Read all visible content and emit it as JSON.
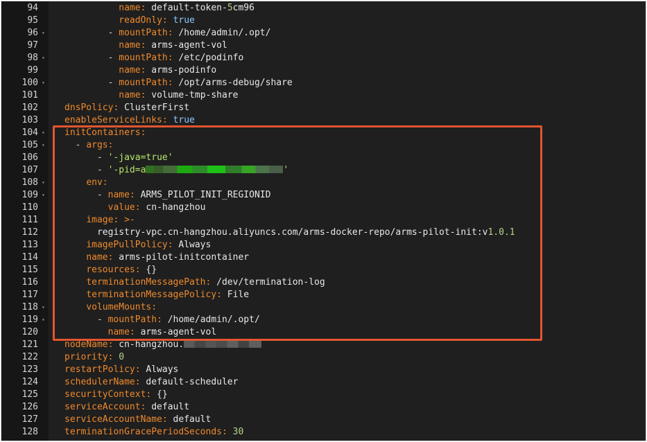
{
  "editor": {
    "lines": [
      {
        "number": "94",
        "segments": [
          {
            "text": "          ",
            "cls": "v"
          },
          {
            "text": "name:",
            "cls": "k"
          },
          {
            "text": " default-token-",
            "cls": "v"
          },
          {
            "text": "5",
            "cls": "n"
          },
          {
            "text": "cm96",
            "cls": "v"
          }
        ]
      },
      {
        "number": "95",
        "segments": [
          {
            "text": "          ",
            "cls": "v"
          },
          {
            "text": "readOnly:",
            "cls": "k"
          },
          {
            "text": " ",
            "cls": "v"
          },
          {
            "text": "true",
            "cls": "b"
          }
        ]
      },
      {
        "number": "96",
        "fold": true,
        "segments": [
          {
            "text": "        - ",
            "cls": "d"
          },
          {
            "text": "mountPath:",
            "cls": "k"
          },
          {
            "text": " /home/admin/.opt/",
            "cls": "v"
          }
        ]
      },
      {
        "number": "97",
        "segments": [
          {
            "text": "          ",
            "cls": "v"
          },
          {
            "text": "name:",
            "cls": "k"
          },
          {
            "text": " arms-agent-vol",
            "cls": "v"
          }
        ]
      },
      {
        "number": "98",
        "fold": true,
        "segments": [
          {
            "text": "        - ",
            "cls": "d"
          },
          {
            "text": "mountPath:",
            "cls": "k"
          },
          {
            "text": " /etc/podinfo",
            "cls": "v"
          }
        ]
      },
      {
        "number": "99",
        "segments": [
          {
            "text": "          ",
            "cls": "v"
          },
          {
            "text": "name:",
            "cls": "k"
          },
          {
            "text": " arms-podinfo",
            "cls": "v"
          }
        ]
      },
      {
        "number": "100",
        "fold": true,
        "segments": [
          {
            "text": "        - ",
            "cls": "d"
          },
          {
            "text": "mountPath:",
            "cls": "k"
          },
          {
            "text": " /opt/arms-debug/share",
            "cls": "v"
          }
        ]
      },
      {
        "number": "101",
        "segments": [
          {
            "text": "          ",
            "cls": "v"
          },
          {
            "text": "name:",
            "cls": "k"
          },
          {
            "text": " volume-tmp-share",
            "cls": "v"
          }
        ]
      },
      {
        "number": "102",
        "segments": [
          {
            "text": "dnsPolicy:",
            "cls": "k"
          },
          {
            "text": " ClusterFirst",
            "cls": "v"
          }
        ]
      },
      {
        "number": "103",
        "segments": [
          {
            "text": "enableServiceLinks:",
            "cls": "k"
          },
          {
            "text": " ",
            "cls": "v"
          },
          {
            "text": "true",
            "cls": "b"
          }
        ]
      },
      {
        "number": "104",
        "fold": true,
        "segments": [
          {
            "text": "initContainers:",
            "cls": "k"
          }
        ]
      },
      {
        "number": "105",
        "fold": true,
        "segments": [
          {
            "text": "  - ",
            "cls": "d"
          },
          {
            "text": "args:",
            "cls": "k"
          }
        ]
      },
      {
        "number": "106",
        "segments": [
          {
            "text": "      - ",
            "cls": "d"
          },
          {
            "text": "'-java=true'",
            "cls": "s"
          }
        ]
      },
      {
        "number": "107",
        "segments": [
          {
            "text": "      - ",
            "cls": "d"
          },
          {
            "text": "'-pid=a",
            "cls": "s"
          },
          {
            "redact": "redact1"
          },
          {
            "text": "'",
            "cls": "s"
          }
        ]
      },
      {
        "number": "108",
        "fold": true,
        "segments": [
          {
            "text": "    ",
            "cls": "v"
          },
          {
            "text": "env:",
            "cls": "k"
          }
        ]
      },
      {
        "number": "109",
        "fold": true,
        "segments": [
          {
            "text": "      - ",
            "cls": "d"
          },
          {
            "text": "name:",
            "cls": "k"
          },
          {
            "text": " ARMS_PILOT_INIT_REGIONID",
            "cls": "v"
          }
        ]
      },
      {
        "number": "110",
        "segments": [
          {
            "text": "        ",
            "cls": "v"
          },
          {
            "text": "value:",
            "cls": "k"
          },
          {
            "text": " cn-hangzhou",
            "cls": "v"
          }
        ]
      },
      {
        "number": "111",
        "segments": [
          {
            "text": "    ",
            "cls": "v"
          },
          {
            "text": "image:",
            "cls": "k"
          },
          {
            "text": " >-",
            "cls": "k"
          }
        ]
      },
      {
        "number": "112",
        "segments": [
          {
            "text": "      registry-vpc.cn-hangzhou.aliyuncs.com/arms-docker-repo/arms-pilot-init:v",
            "cls": "v"
          },
          {
            "text": "1.0.1",
            "cls": "n"
          }
        ]
      },
      {
        "number": "113",
        "segments": [
          {
            "text": "    ",
            "cls": "v"
          },
          {
            "text": "imagePullPolicy:",
            "cls": "k"
          },
          {
            "text": " Always",
            "cls": "v"
          }
        ]
      },
      {
        "number": "114",
        "segments": [
          {
            "text": "    ",
            "cls": "v"
          },
          {
            "text": "name:",
            "cls": "k"
          },
          {
            "text": " arms-pilot-initcontainer",
            "cls": "v"
          }
        ]
      },
      {
        "number": "115",
        "segments": [
          {
            "text": "    ",
            "cls": "v"
          },
          {
            "text": "resources:",
            "cls": "k"
          },
          {
            "text": " {}",
            "cls": "v"
          }
        ]
      },
      {
        "number": "116",
        "segments": [
          {
            "text": "    ",
            "cls": "v"
          },
          {
            "text": "terminationMessagePath:",
            "cls": "k"
          },
          {
            "text": " /dev/termination-log",
            "cls": "v"
          }
        ]
      },
      {
        "number": "117",
        "segments": [
          {
            "text": "    ",
            "cls": "v"
          },
          {
            "text": "terminationMessagePolicy:",
            "cls": "k"
          },
          {
            "text": " File",
            "cls": "v"
          }
        ]
      },
      {
        "number": "118",
        "fold": true,
        "segments": [
          {
            "text": "    ",
            "cls": "v"
          },
          {
            "text": "volumeMounts:",
            "cls": "k"
          }
        ]
      },
      {
        "number": "119",
        "fold": true,
        "segments": [
          {
            "text": "      - ",
            "cls": "d"
          },
          {
            "text": "mountPath:",
            "cls": "k"
          },
          {
            "text": " /home/admin/.opt/",
            "cls": "v"
          }
        ]
      },
      {
        "number": "120",
        "segments": [
          {
            "text": "        ",
            "cls": "v"
          },
          {
            "text": "name:",
            "cls": "k"
          },
          {
            "text": " arms-agent-vol",
            "cls": "v"
          }
        ]
      },
      {
        "number": "121",
        "segments": [
          {
            "text": "nodeName:",
            "cls": "k"
          },
          {
            "text": " cn-hangzhou.",
            "cls": "v"
          },
          {
            "redact": "redact2"
          }
        ]
      },
      {
        "number": "122",
        "segments": [
          {
            "text": "priority:",
            "cls": "k"
          },
          {
            "text": " ",
            "cls": "v"
          },
          {
            "text": "0",
            "cls": "n"
          }
        ]
      },
      {
        "number": "123",
        "segments": [
          {
            "text": "restartPolicy:",
            "cls": "k"
          },
          {
            "text": " Always",
            "cls": "v"
          }
        ]
      },
      {
        "number": "124",
        "segments": [
          {
            "text": "schedulerName:",
            "cls": "k"
          },
          {
            "text": " default-scheduler",
            "cls": "v"
          }
        ]
      },
      {
        "number": "125",
        "segments": [
          {
            "text": "securityContext:",
            "cls": "k"
          },
          {
            "text": " {}",
            "cls": "v"
          }
        ]
      },
      {
        "number": "126",
        "segments": [
          {
            "text": "serviceAccount:",
            "cls": "k"
          },
          {
            "text": " default",
            "cls": "v"
          }
        ]
      },
      {
        "number": "127",
        "segments": [
          {
            "text": "serviceAccountName:",
            "cls": "k"
          },
          {
            "text": " default",
            "cls": "v"
          }
        ]
      },
      {
        "number": "128",
        "segments": [
          {
            "text": "terminationGracePeriodSeconds:",
            "cls": "k"
          },
          {
            "text": " ",
            "cls": "v"
          },
          {
            "text": "30",
            "cls": "n"
          }
        ]
      }
    ]
  },
  "colors": {
    "background": "#1f1f1f",
    "gutter": "#161616",
    "key": "#ef8a2d",
    "string": "#b8e86a",
    "boolean": "#8fc8ff",
    "highlight_box": "#e4552f"
  }
}
